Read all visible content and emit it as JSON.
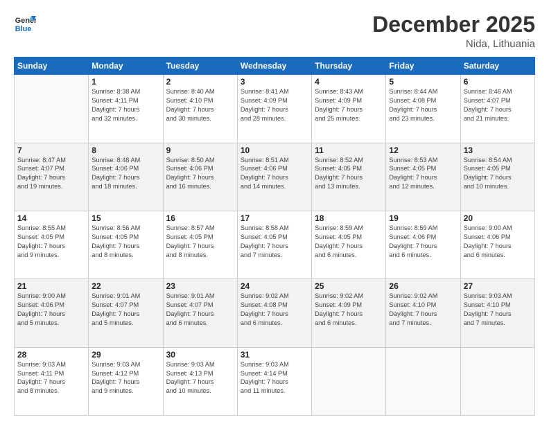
{
  "header": {
    "logo_general": "General",
    "logo_blue": "Blue",
    "month_year": "December 2025",
    "location": "Nida, Lithuania"
  },
  "weekdays": [
    "Sunday",
    "Monday",
    "Tuesday",
    "Wednesday",
    "Thursday",
    "Friday",
    "Saturday"
  ],
  "weeks": [
    [
      {
        "day": "",
        "info": ""
      },
      {
        "day": "1",
        "info": "Sunrise: 8:38 AM\nSunset: 4:11 PM\nDaylight: 7 hours\nand 32 minutes."
      },
      {
        "day": "2",
        "info": "Sunrise: 8:40 AM\nSunset: 4:10 PM\nDaylight: 7 hours\nand 30 minutes."
      },
      {
        "day": "3",
        "info": "Sunrise: 8:41 AM\nSunset: 4:09 PM\nDaylight: 7 hours\nand 28 minutes."
      },
      {
        "day": "4",
        "info": "Sunrise: 8:43 AM\nSunset: 4:09 PM\nDaylight: 7 hours\nand 25 minutes."
      },
      {
        "day": "5",
        "info": "Sunrise: 8:44 AM\nSunset: 4:08 PM\nDaylight: 7 hours\nand 23 minutes."
      },
      {
        "day": "6",
        "info": "Sunrise: 8:46 AM\nSunset: 4:07 PM\nDaylight: 7 hours\nand 21 minutes."
      }
    ],
    [
      {
        "day": "7",
        "info": "Sunrise: 8:47 AM\nSunset: 4:07 PM\nDaylight: 7 hours\nand 19 minutes."
      },
      {
        "day": "8",
        "info": "Sunrise: 8:48 AM\nSunset: 4:06 PM\nDaylight: 7 hours\nand 18 minutes."
      },
      {
        "day": "9",
        "info": "Sunrise: 8:50 AM\nSunset: 4:06 PM\nDaylight: 7 hours\nand 16 minutes."
      },
      {
        "day": "10",
        "info": "Sunrise: 8:51 AM\nSunset: 4:06 PM\nDaylight: 7 hours\nand 14 minutes."
      },
      {
        "day": "11",
        "info": "Sunrise: 8:52 AM\nSunset: 4:05 PM\nDaylight: 7 hours\nand 13 minutes."
      },
      {
        "day": "12",
        "info": "Sunrise: 8:53 AM\nSunset: 4:05 PM\nDaylight: 7 hours\nand 12 minutes."
      },
      {
        "day": "13",
        "info": "Sunrise: 8:54 AM\nSunset: 4:05 PM\nDaylight: 7 hours\nand 10 minutes."
      }
    ],
    [
      {
        "day": "14",
        "info": "Sunrise: 8:55 AM\nSunset: 4:05 PM\nDaylight: 7 hours\nand 9 minutes."
      },
      {
        "day": "15",
        "info": "Sunrise: 8:56 AM\nSunset: 4:05 PM\nDaylight: 7 hours\nand 8 minutes."
      },
      {
        "day": "16",
        "info": "Sunrise: 8:57 AM\nSunset: 4:05 PM\nDaylight: 7 hours\nand 8 minutes."
      },
      {
        "day": "17",
        "info": "Sunrise: 8:58 AM\nSunset: 4:05 PM\nDaylight: 7 hours\nand 7 minutes."
      },
      {
        "day": "18",
        "info": "Sunrise: 8:59 AM\nSunset: 4:05 PM\nDaylight: 7 hours\nand 6 minutes."
      },
      {
        "day": "19",
        "info": "Sunrise: 8:59 AM\nSunset: 4:06 PM\nDaylight: 7 hours\nand 6 minutes."
      },
      {
        "day": "20",
        "info": "Sunrise: 9:00 AM\nSunset: 4:06 PM\nDaylight: 7 hours\nand 6 minutes."
      }
    ],
    [
      {
        "day": "21",
        "info": "Sunrise: 9:00 AM\nSunset: 4:06 PM\nDaylight: 7 hours\nand 5 minutes."
      },
      {
        "day": "22",
        "info": "Sunrise: 9:01 AM\nSunset: 4:07 PM\nDaylight: 7 hours\nand 5 minutes."
      },
      {
        "day": "23",
        "info": "Sunrise: 9:01 AM\nSunset: 4:07 PM\nDaylight: 7 hours\nand 6 minutes."
      },
      {
        "day": "24",
        "info": "Sunrise: 9:02 AM\nSunset: 4:08 PM\nDaylight: 7 hours\nand 6 minutes."
      },
      {
        "day": "25",
        "info": "Sunrise: 9:02 AM\nSunset: 4:09 PM\nDaylight: 7 hours\nand 6 minutes."
      },
      {
        "day": "26",
        "info": "Sunrise: 9:02 AM\nSunset: 4:10 PM\nDaylight: 7 hours\nand 7 minutes."
      },
      {
        "day": "27",
        "info": "Sunrise: 9:03 AM\nSunset: 4:10 PM\nDaylight: 7 hours\nand 7 minutes."
      }
    ],
    [
      {
        "day": "28",
        "info": "Sunrise: 9:03 AM\nSunset: 4:11 PM\nDaylight: 7 hours\nand 8 minutes."
      },
      {
        "day": "29",
        "info": "Sunrise: 9:03 AM\nSunset: 4:12 PM\nDaylight: 7 hours\nand 9 minutes."
      },
      {
        "day": "30",
        "info": "Sunrise: 9:03 AM\nSunset: 4:13 PM\nDaylight: 7 hours\nand 10 minutes."
      },
      {
        "day": "31",
        "info": "Sunrise: 9:03 AM\nSunset: 4:14 PM\nDaylight: 7 hours\nand 11 minutes."
      },
      {
        "day": "",
        "info": ""
      },
      {
        "day": "",
        "info": ""
      },
      {
        "day": "",
        "info": ""
      }
    ]
  ]
}
